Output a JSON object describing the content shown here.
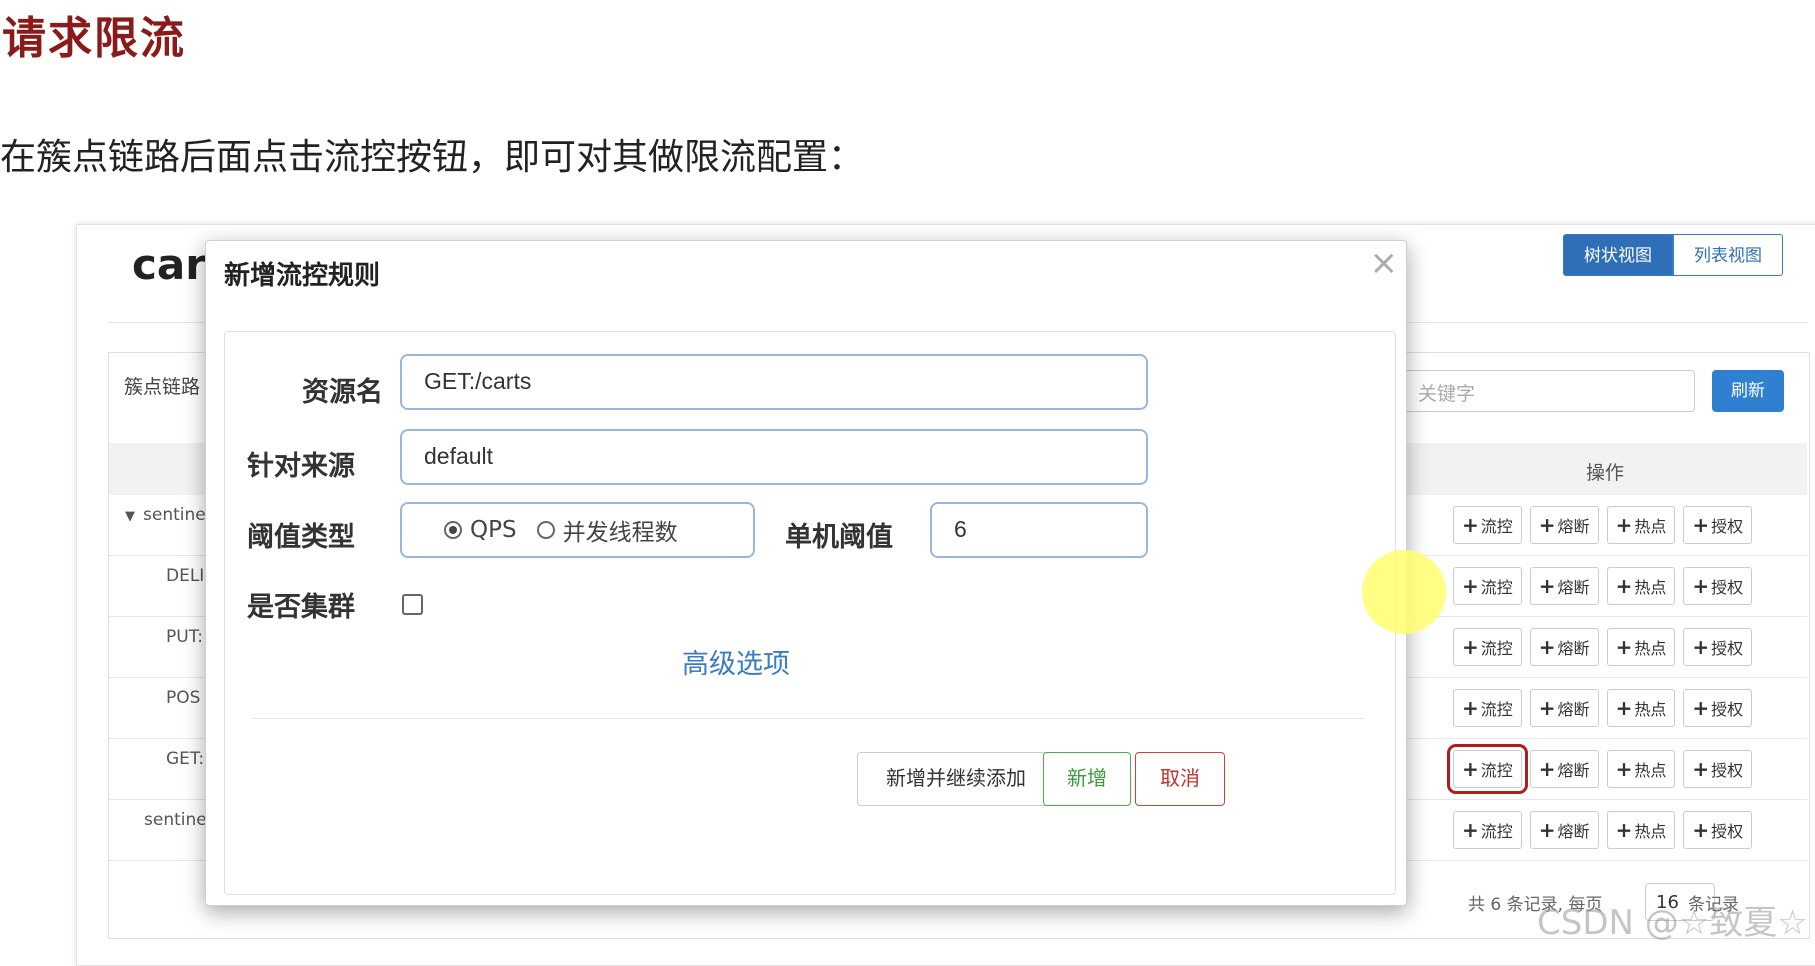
{
  "doc": {
    "title": "请求限流",
    "text": "在簇点链路后面点击流控按钮，即可对其做限流配置："
  },
  "background": {
    "title": "cart",
    "views": [
      "树状视图",
      "列表视图"
    ],
    "section_label": "簇点链路",
    "search_placeholder": "关键字",
    "refresh_label": "刷新",
    "op_header": "操作",
    "rows": [
      {
        "left": "sentine",
        "tree": true
      },
      {
        "left": "DELI",
        "tree": false
      },
      {
        "left": "PUT:",
        "tree": false
      },
      {
        "left": "POS",
        "tree": false
      },
      {
        "left": "GET:",
        "tree": false
      },
      {
        "left": "sentinel",
        "tree": false
      }
    ],
    "ops": [
      "流控",
      "熔断",
      "热点",
      "授权"
    ],
    "highlighted_row": 4,
    "pager": {
      "total_text": "共 6 条记录, 每页",
      "page_size": "16",
      "unit": "条记录"
    },
    "watermark": "CSDN @☆致夏☆"
  },
  "modal": {
    "title": "新增流控规则",
    "close_symbol": "×",
    "fields": {
      "resource_label": "资源名",
      "resource_value": "GET:/carts",
      "origin_label": "针对来源",
      "origin_value": "default",
      "threshold_type_label": "阈值类型",
      "threshold_type_options": [
        "QPS",
        "并发线程数"
      ],
      "threshold_type_selected": "QPS",
      "single_threshold_label": "单机阈值",
      "single_threshold_value": "6",
      "cluster_label": "是否集群",
      "cluster_checked": false
    },
    "advanced_link": "高级选项",
    "buttons": {
      "continue": "新增并继续添加",
      "add": "新增",
      "cancel": "取消"
    }
  },
  "colors": {
    "doc_title": "#8b1a1a",
    "primary": "#2f80d1",
    "success": "#4cae4c",
    "danger": "#d43f3a",
    "highlight_box": "#b01c1c",
    "cursor": "#ffff6e"
  }
}
